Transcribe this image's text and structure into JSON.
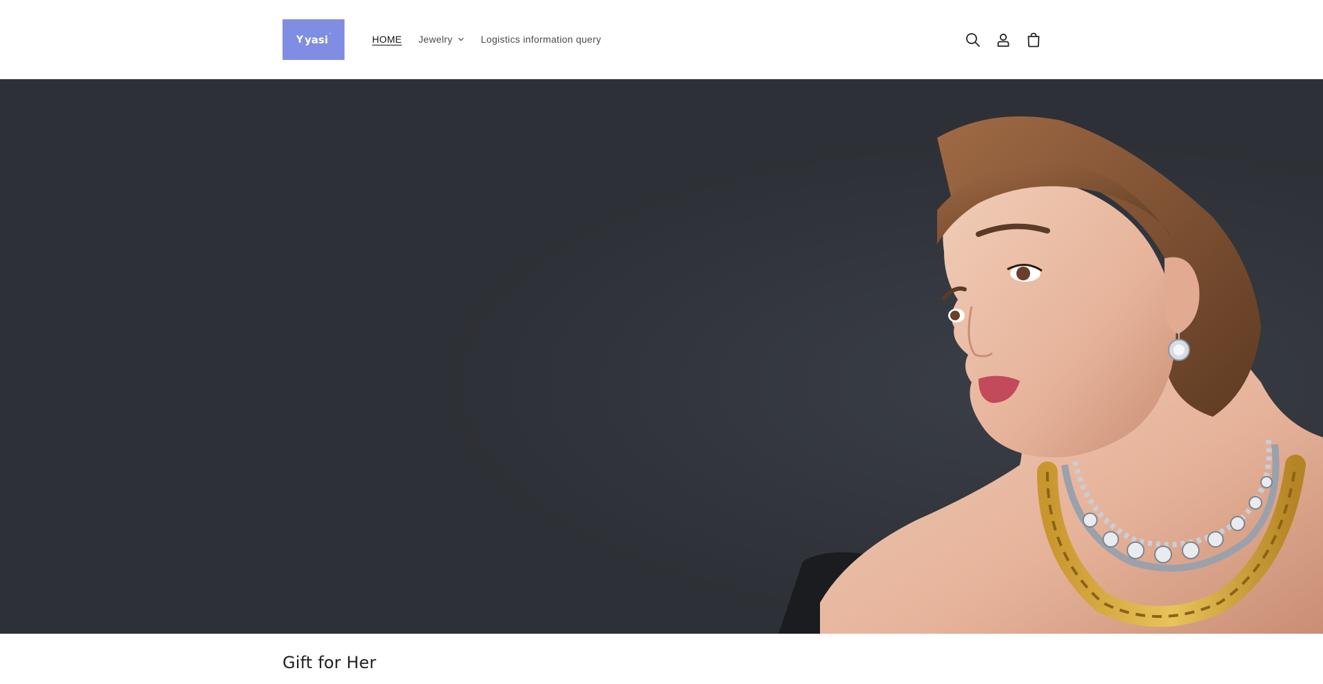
{
  "header": {
    "logo": {
      "text": "yasi",
      "mark": "Y",
      "background_color": "#7f8ee3"
    },
    "nav": {
      "home": "HOME",
      "jewelry": "Jewelry",
      "logistics": "Logistics information query"
    },
    "icons": {
      "search": "search-icon",
      "account": "account-icon",
      "cart": "cart-icon"
    }
  },
  "hero": {
    "background_color": "#2d3036",
    "image": "woman-with-necklaces-and-earring"
  },
  "collection": {
    "title": "Gift for Her"
  }
}
